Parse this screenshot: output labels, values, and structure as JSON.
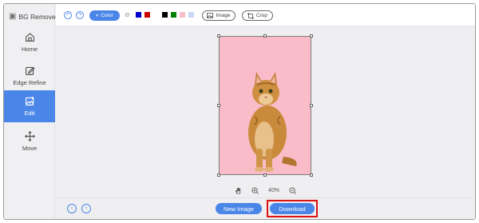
{
  "app": {
    "title": "BG Remover"
  },
  "sidebar": {
    "items": [
      {
        "label": "Home",
        "icon": "home-icon"
      },
      {
        "label": "Edge Refine",
        "icon": "edge-refine-icon"
      },
      {
        "label": "Edit",
        "icon": "edit-image-icon",
        "active": true
      },
      {
        "label": "Move",
        "icon": "move-icon"
      }
    ]
  },
  "toolbar": {
    "color_label": "Color",
    "swatches": [
      "#0000cc",
      "#cc0000",
      "#ffffff",
      "#000000",
      "#008000",
      "#f9bcc8",
      "#c8d8f5"
    ],
    "image_label": "Image",
    "crop_label": "Crop"
  },
  "canvas": {
    "background_color": "#f9bcc8"
  },
  "zoom": {
    "level": "40%"
  },
  "footer": {
    "new_image_label": "New Image",
    "download_label": "Download"
  },
  "colors": {
    "accent": "#4a86e8",
    "highlight": "#dd1111"
  }
}
